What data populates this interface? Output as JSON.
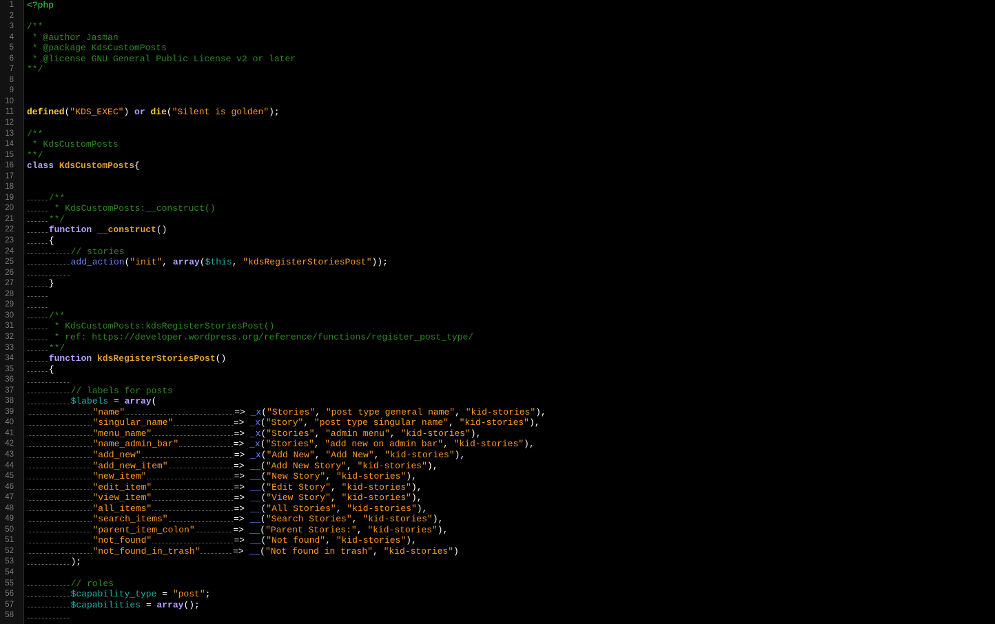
{
  "editor": {
    "gutter_color": "#121212",
    "background": "#000000",
    "lines": [
      [
        [
          "php",
          "<?php"
        ]
      ],
      [],
      [
        [
          "comment",
          "/**"
        ]
      ],
      [
        [
          "comment",
          " * @author Jasman"
        ]
      ],
      [
        [
          "comment",
          " * @package KdsCustomPosts"
        ]
      ],
      [
        [
          "comment",
          " * @license GNU General Public License v2 or later"
        ]
      ],
      [
        [
          "comment",
          "**/"
        ]
      ],
      [],
      [],
      [],
      [
        [
          "kw",
          "defined"
        ],
        [
          "punc",
          "("
        ],
        [
          "str",
          "\"KDS_EXEC\""
        ],
        [
          "punc",
          ") "
        ],
        [
          "kw2",
          "or"
        ],
        [
          "punc",
          " "
        ],
        [
          "kw",
          "die"
        ],
        [
          "punc",
          "("
        ],
        [
          "str",
          "\"Silent is golden\""
        ],
        [
          "punc",
          ");"
        ]
      ],
      [],
      [
        [
          "comment",
          "/**"
        ]
      ],
      [
        [
          "comment",
          " * KdsCustomPosts"
        ]
      ],
      [
        [
          "comment",
          "**/"
        ]
      ],
      [
        [
          "kw2",
          "class"
        ],
        [
          "punc",
          " "
        ],
        [
          "fn",
          "KdsCustomPosts"
        ],
        [
          "punc",
          "{"
        ]
      ],
      [],
      [],
      [
        [
          "ws",
          "    "
        ],
        [
          "comment",
          "/**"
        ]
      ],
      [
        [
          "ws",
          "    "
        ],
        [
          "comment",
          " * KdsCustomPosts:__construct()"
        ]
      ],
      [
        [
          "ws",
          "    "
        ],
        [
          "comment",
          "**/"
        ]
      ],
      [
        [
          "ws",
          "    "
        ],
        [
          "kw2",
          "function"
        ],
        [
          "punc",
          " "
        ],
        [
          "fn",
          "__construct"
        ],
        [
          "punc",
          "()"
        ]
      ],
      [
        [
          "ws",
          "    "
        ],
        [
          "punc",
          "{"
        ]
      ],
      [
        [
          "ws",
          "        "
        ],
        [
          "comment",
          "// stories"
        ]
      ],
      [
        [
          "ws",
          "        "
        ],
        [
          "call",
          "add_action"
        ],
        [
          "punc",
          "("
        ],
        [
          "str",
          "\"init\""
        ],
        [
          "punc",
          ", "
        ],
        [
          "kw2",
          "array"
        ],
        [
          "punc",
          "("
        ],
        [
          "var",
          "$this"
        ],
        [
          "punc",
          ", "
        ],
        [
          "str",
          "\"kdsRegisterStoriesPost\""
        ],
        [
          "punc",
          "));"
        ]
      ],
      [
        [
          "ws",
          "        "
        ]
      ],
      [
        [
          "ws",
          "    "
        ],
        [
          "punc",
          "}"
        ]
      ],
      [
        [
          "ws",
          "    "
        ]
      ],
      [
        [
          "ws",
          "    "
        ]
      ],
      [
        [
          "ws",
          "    "
        ],
        [
          "comment",
          "/**"
        ]
      ],
      [
        [
          "ws",
          "    "
        ],
        [
          "comment",
          " * KdsCustomPosts:kdsRegisterStoriesPost()"
        ]
      ],
      [
        [
          "ws",
          "    "
        ],
        [
          "comment",
          " * ref: https://developer.wordpress.org/reference/functions/register_post_type/"
        ]
      ],
      [
        [
          "ws",
          "    "
        ],
        [
          "comment",
          "**/"
        ]
      ],
      [
        [
          "ws",
          "    "
        ],
        [
          "kw2",
          "function"
        ],
        [
          "punc",
          " "
        ],
        [
          "fn",
          "kdsRegisterStoriesPost"
        ],
        [
          "punc",
          "()"
        ]
      ],
      [
        [
          "ws",
          "    "
        ],
        [
          "punc",
          "{"
        ]
      ],
      [
        [
          "ws",
          "        "
        ]
      ],
      [
        [
          "ws",
          "        "
        ],
        [
          "comment",
          "// labels for posts"
        ]
      ],
      [
        [
          "ws",
          "        "
        ],
        [
          "var",
          "$labels"
        ],
        [
          "punc",
          " = "
        ],
        [
          "kw2",
          "array"
        ],
        [
          "punc",
          "("
        ]
      ],
      [
        [
          "ws",
          "            "
        ],
        [
          "str",
          "\"name\""
        ],
        [
          "ws",
          "                    "
        ],
        [
          "op",
          "=> "
        ],
        [
          "call",
          "_x"
        ],
        [
          "punc",
          "("
        ],
        [
          "str",
          "\"Stories\""
        ],
        [
          "punc",
          ", "
        ],
        [
          "str",
          "\"post type general name\""
        ],
        [
          "punc",
          ", "
        ],
        [
          "str",
          "\"kid-stories\""
        ],
        [
          "punc",
          "),"
        ]
      ],
      [
        [
          "ws",
          "            "
        ],
        [
          "str",
          "\"singular_name\""
        ],
        [
          "ws",
          "           "
        ],
        [
          "op",
          "=> "
        ],
        [
          "call",
          "_x"
        ],
        [
          "punc",
          "("
        ],
        [
          "str",
          "\"Story\""
        ],
        [
          "punc",
          ", "
        ],
        [
          "str",
          "\"post type singular name\""
        ],
        [
          "punc",
          ", "
        ],
        [
          "str",
          "\"kid-stories\""
        ],
        [
          "punc",
          "),"
        ]
      ],
      [
        [
          "ws",
          "            "
        ],
        [
          "str",
          "\"menu_name\""
        ],
        [
          "ws",
          "               "
        ],
        [
          "op",
          "=> "
        ],
        [
          "call",
          "_x"
        ],
        [
          "punc",
          "("
        ],
        [
          "str",
          "\"Stories\""
        ],
        [
          "punc",
          ", "
        ],
        [
          "str",
          "\"admin menu\""
        ],
        [
          "punc",
          ", "
        ],
        [
          "str",
          "\"kid-stories\""
        ],
        [
          "punc",
          "),"
        ]
      ],
      [
        [
          "ws",
          "            "
        ],
        [
          "str",
          "\"name_admin_bar\""
        ],
        [
          "ws",
          "          "
        ],
        [
          "op",
          "=> "
        ],
        [
          "call",
          "_x"
        ],
        [
          "punc",
          "("
        ],
        [
          "str",
          "\"Stories\""
        ],
        [
          "punc",
          ", "
        ],
        [
          "str",
          "\"add new on admin bar\""
        ],
        [
          "punc",
          ", "
        ],
        [
          "str",
          "\"kid-stories\""
        ],
        [
          "punc",
          "),"
        ]
      ],
      [
        [
          "ws",
          "            "
        ],
        [
          "str",
          "\"add_new\""
        ],
        [
          "ws",
          "                 "
        ],
        [
          "op",
          "=> "
        ],
        [
          "call",
          "_x"
        ],
        [
          "punc",
          "("
        ],
        [
          "str",
          "\"Add New\""
        ],
        [
          "punc",
          ", "
        ],
        [
          "str",
          "\"Add New\""
        ],
        [
          "punc",
          ", "
        ],
        [
          "str",
          "\"kid-stories\""
        ],
        [
          "punc",
          "),"
        ]
      ],
      [
        [
          "ws",
          "            "
        ],
        [
          "str",
          "\"add_new_item\""
        ],
        [
          "ws",
          "            "
        ],
        [
          "op",
          "=> "
        ],
        [
          "call",
          "__"
        ],
        [
          "punc",
          "("
        ],
        [
          "str",
          "\"Add New Story\""
        ],
        [
          "punc",
          ", "
        ],
        [
          "str",
          "\"kid-stories\""
        ],
        [
          "punc",
          "),"
        ]
      ],
      [
        [
          "ws",
          "            "
        ],
        [
          "str",
          "\"new_item\""
        ],
        [
          "ws",
          "                "
        ],
        [
          "op",
          "=> "
        ],
        [
          "call",
          "__"
        ],
        [
          "punc",
          "("
        ],
        [
          "str",
          "\"New Story\""
        ],
        [
          "punc",
          ", "
        ],
        [
          "str",
          "\"kid-stories\""
        ],
        [
          "punc",
          "),"
        ]
      ],
      [
        [
          "ws",
          "            "
        ],
        [
          "str",
          "\"edit_item\""
        ],
        [
          "ws",
          "               "
        ],
        [
          "op",
          "=> "
        ],
        [
          "call",
          "__"
        ],
        [
          "punc",
          "("
        ],
        [
          "str",
          "\"Edit Story\""
        ],
        [
          "punc",
          ", "
        ],
        [
          "str",
          "\"kid-stories\""
        ],
        [
          "punc",
          "),"
        ]
      ],
      [
        [
          "ws",
          "            "
        ],
        [
          "str",
          "\"view_item\""
        ],
        [
          "ws",
          "               "
        ],
        [
          "op",
          "=> "
        ],
        [
          "call",
          "__"
        ],
        [
          "punc",
          "("
        ],
        [
          "str",
          "\"View Story\""
        ],
        [
          "punc",
          ", "
        ],
        [
          "str",
          "\"kid-stories\""
        ],
        [
          "punc",
          "),"
        ]
      ],
      [
        [
          "ws",
          "            "
        ],
        [
          "str",
          "\"all_items\""
        ],
        [
          "ws",
          "               "
        ],
        [
          "op",
          "=> "
        ],
        [
          "call",
          "__"
        ],
        [
          "punc",
          "("
        ],
        [
          "str",
          "\"All Stories\""
        ],
        [
          "punc",
          ", "
        ],
        [
          "str",
          "\"kid-stories\""
        ],
        [
          "punc",
          "),"
        ]
      ],
      [
        [
          "ws",
          "            "
        ],
        [
          "str",
          "\"search_items\""
        ],
        [
          "ws",
          "            "
        ],
        [
          "op",
          "=> "
        ],
        [
          "call",
          "__"
        ],
        [
          "punc",
          "("
        ],
        [
          "str",
          "\"Search Stories\""
        ],
        [
          "punc",
          ", "
        ],
        [
          "str",
          "\"kid-stories\""
        ],
        [
          "punc",
          "),"
        ]
      ],
      [
        [
          "ws",
          "            "
        ],
        [
          "str",
          "\"parent_item_colon\""
        ],
        [
          "ws",
          "       "
        ],
        [
          "op",
          "=> "
        ],
        [
          "call",
          "__"
        ],
        [
          "punc",
          "("
        ],
        [
          "str",
          "\"Parent Stories:\""
        ],
        [
          "punc",
          ", "
        ],
        [
          "str",
          "\"kid-stories\""
        ],
        [
          "punc",
          "),"
        ]
      ],
      [
        [
          "ws",
          "            "
        ],
        [
          "str",
          "\"not_found\""
        ],
        [
          "ws",
          "               "
        ],
        [
          "op",
          "=> "
        ],
        [
          "call",
          "__"
        ],
        [
          "punc",
          "("
        ],
        [
          "str",
          "\"Not found\""
        ],
        [
          "punc",
          ", "
        ],
        [
          "str",
          "\"kid-stories\""
        ],
        [
          "punc",
          "),"
        ]
      ],
      [
        [
          "ws",
          "            "
        ],
        [
          "str",
          "\"not_found_in_trash\""
        ],
        [
          "ws",
          "      "
        ],
        [
          "op",
          "=> "
        ],
        [
          "call",
          "__"
        ],
        [
          "punc",
          "("
        ],
        [
          "str",
          "\"Not found in trash\""
        ],
        [
          "punc",
          ", "
        ],
        [
          "str",
          "\"kid-stories\""
        ],
        [
          "punc",
          ")"
        ]
      ],
      [
        [
          "ws",
          "        "
        ],
        [
          "punc",
          ");"
        ]
      ],
      [],
      [
        [
          "ws",
          "        "
        ],
        [
          "comment",
          "// roles"
        ]
      ],
      [
        [
          "ws",
          "        "
        ],
        [
          "var",
          "$capability_type"
        ],
        [
          "punc",
          " = "
        ],
        [
          "str",
          "\"post\""
        ],
        [
          "punc",
          ";"
        ]
      ],
      [
        [
          "ws",
          "        "
        ],
        [
          "var",
          "$capabilities"
        ],
        [
          "punc",
          " = "
        ],
        [
          "kw2",
          "array"
        ],
        [
          "punc",
          "();"
        ]
      ],
      [
        [
          "ws",
          "        "
        ]
      ]
    ]
  }
}
